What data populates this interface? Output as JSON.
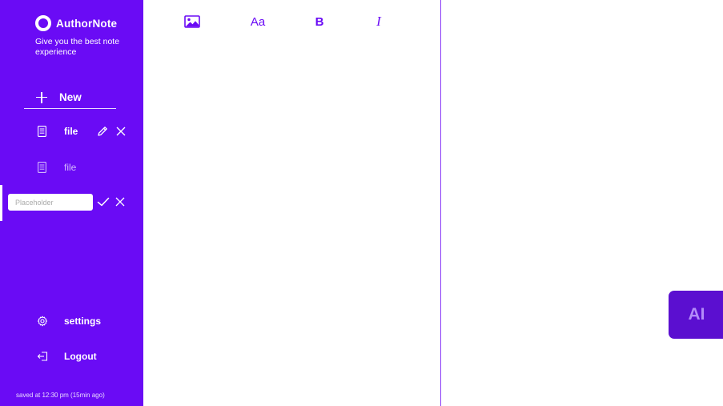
{
  "app": {
    "name": "AuthorNote",
    "tagline": "Give you the best note experience"
  },
  "sidebar": {
    "new_label": "New",
    "files": [
      {
        "label": "file",
        "state": "active"
      },
      {
        "label": "file",
        "state": "inactive"
      }
    ],
    "rename": {
      "placeholder": "Placeholder",
      "value": ""
    },
    "menu": {
      "settings_label": "settings",
      "logout_label": "Logout"
    },
    "status_text": "saved at 12:30 pm (15min ago)"
  },
  "toolbar": {
    "font_label": "Aa",
    "bold_label": "B",
    "italic_label": "I",
    "icons": [
      "image-icon",
      "font-size-icon",
      "bold-icon",
      "italic-icon"
    ]
  },
  "ai_button": {
    "label": "AI"
  },
  "colors": {
    "brand": "#6a0bf5",
    "ai_button": "#5b0fd0",
    "ai_text": "#b38cf9",
    "surface": "#ffffff"
  }
}
